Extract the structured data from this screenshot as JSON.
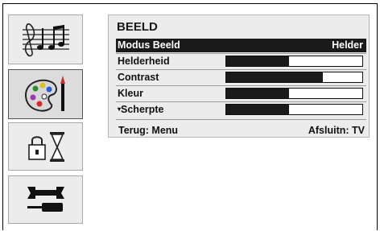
{
  "sidebar": {
    "items": [
      {
        "icon": "music-icon",
        "active": false
      },
      {
        "icon": "picture-palette-icon",
        "active": true
      },
      {
        "icon": "lock-timer-icon",
        "active": false
      },
      {
        "icon": "tools-icon",
        "active": false
      }
    ]
  },
  "menu": {
    "title": "BEELD",
    "rows": [
      {
        "label": "Modus Beeld",
        "value": "Helder",
        "selected": true
      },
      {
        "label": "Helderheid",
        "level": 0.46
      },
      {
        "label": "Contrast",
        "level": 0.71
      },
      {
        "label": "Kleur",
        "level": 0.46
      },
      {
        "label": "Scherpte",
        "level": 0.46,
        "scroll_marker": "▾"
      }
    ],
    "footer": {
      "back": "Terug: Menu",
      "exit": "Afsluitn: TV"
    }
  },
  "colors": {
    "panel_bg": "#ececec",
    "selected_bg": "#1a1a1a",
    "bar_fill": "#1a1a1a"
  }
}
